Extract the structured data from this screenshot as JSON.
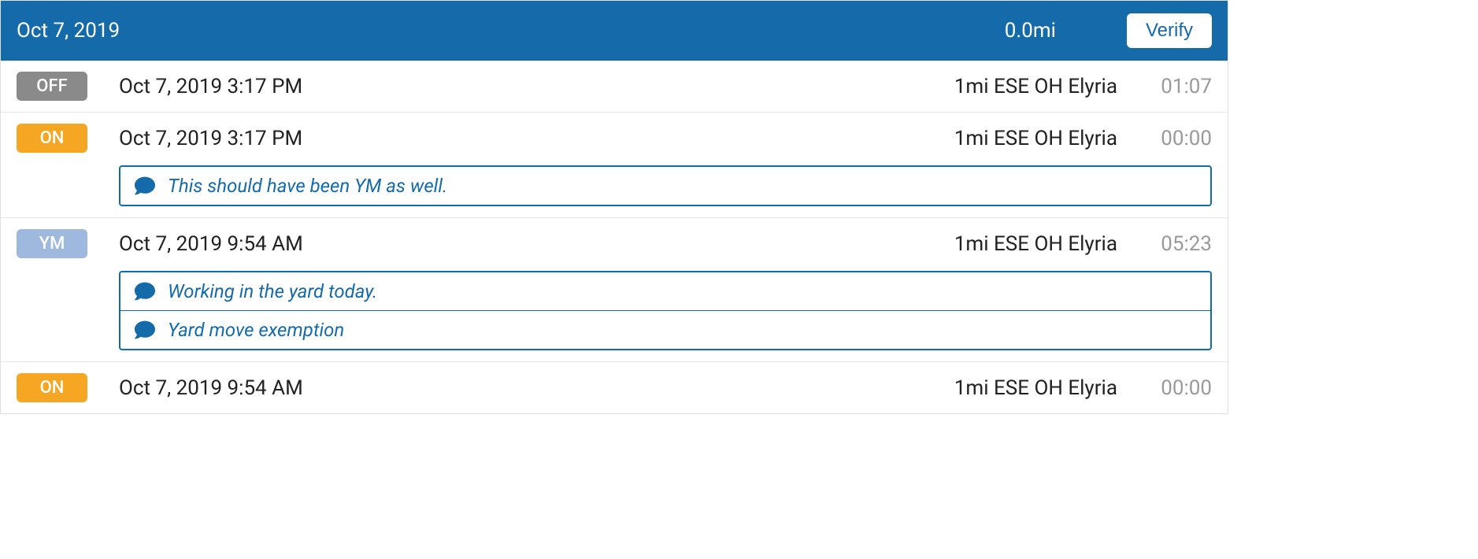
{
  "header": {
    "date": "Oct 7, 2019",
    "distance": "0.0mi",
    "verify_label": "Verify"
  },
  "rows": [
    {
      "status": "OFF",
      "status_class": "badge-off",
      "time": "Oct 7, 2019 3:17 PM",
      "location": "1mi ESE OH Elyria",
      "duration": "01:07",
      "comments": []
    },
    {
      "status": "ON",
      "status_class": "badge-on",
      "time": "Oct 7, 2019 3:17 PM",
      "location": "1mi ESE OH Elyria",
      "duration": "00:00",
      "comments": [
        "This should have been YM as well."
      ]
    },
    {
      "status": "YM",
      "status_class": "badge-ym",
      "time": "Oct 7, 2019 9:54 AM",
      "location": "1mi ESE OH Elyria",
      "duration": "05:23",
      "comments": [
        "Working in the yard today.",
        "Yard move exemption"
      ]
    },
    {
      "status": "ON",
      "status_class": "badge-on",
      "time": "Oct 7, 2019 9:54 AM",
      "location": "1mi ESE OH Elyria",
      "duration": "00:00",
      "comments": []
    }
  ]
}
